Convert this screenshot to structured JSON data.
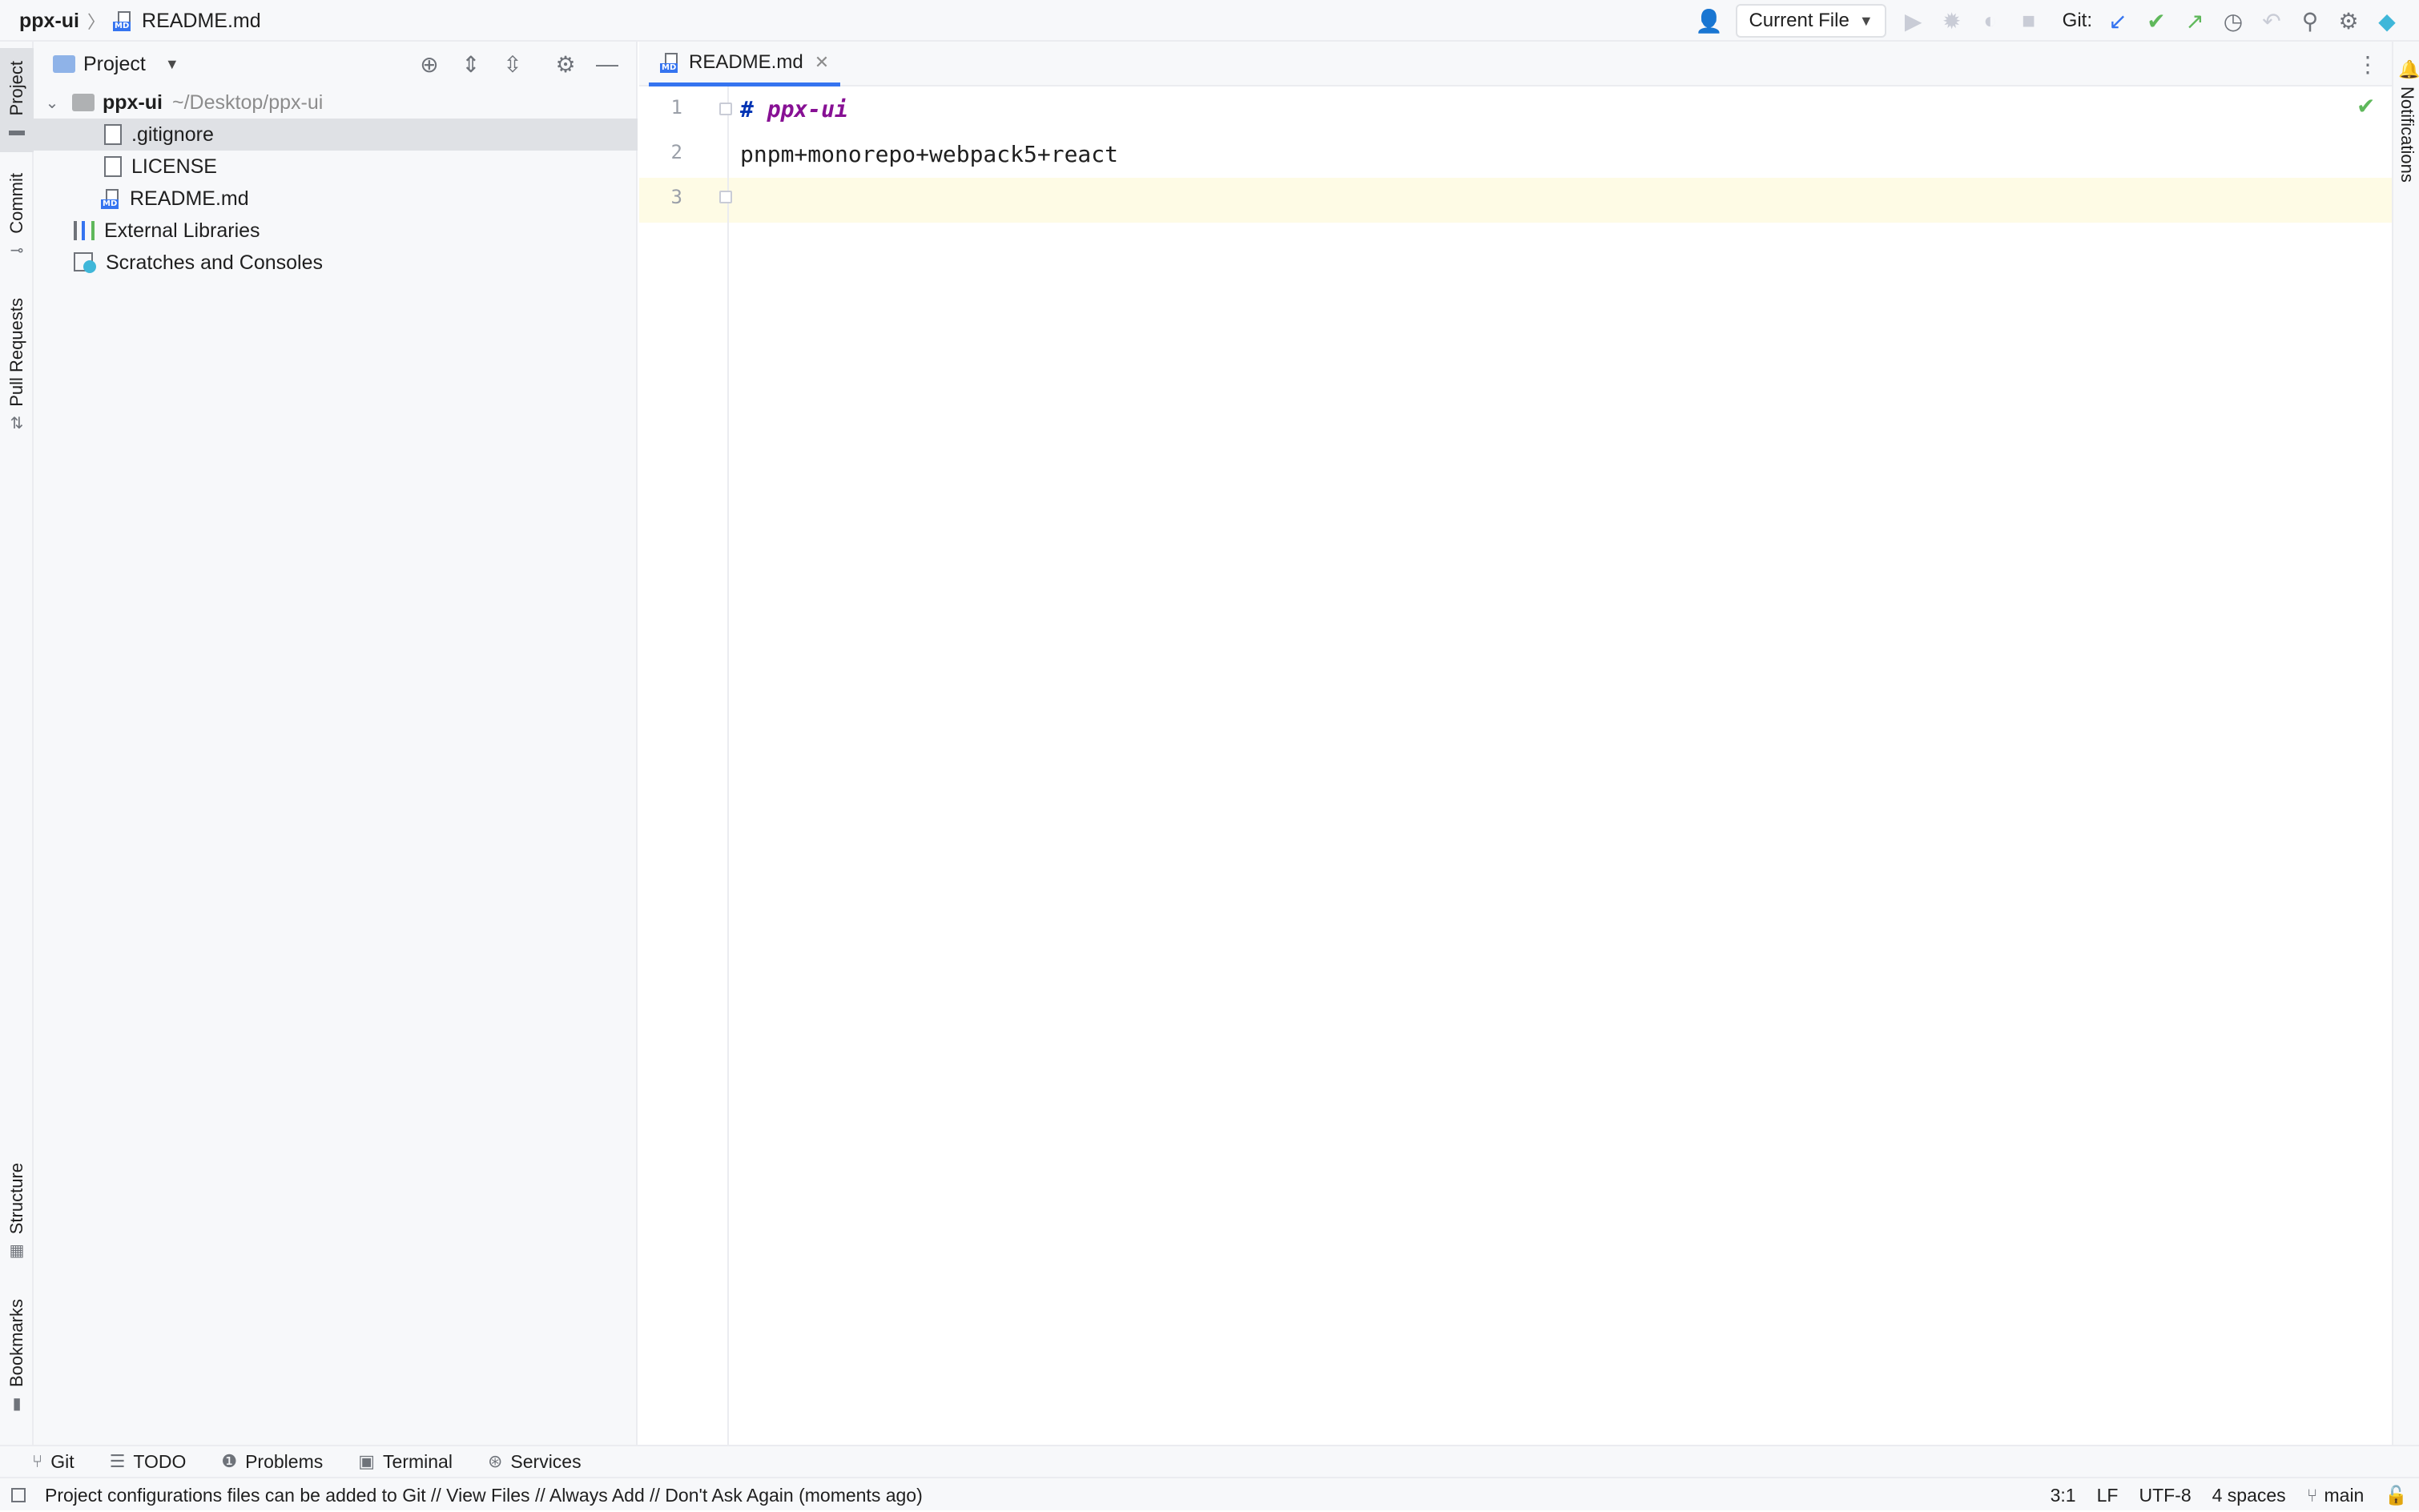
{
  "breadcrumb": {
    "project": "ppx-ui",
    "file": "README.md",
    "file_icon_tag": "MD"
  },
  "toolbar": {
    "run_config": "Current File",
    "git_label": "Git:"
  },
  "left_strip": {
    "project": "Project",
    "commit": "Commit",
    "pull_requests": "Pull Requests",
    "structure": "Structure",
    "bookmarks": "Bookmarks"
  },
  "right_strip": {
    "notifications": "Notifications"
  },
  "project_panel": {
    "title": "Project",
    "tree": [
      {
        "name": "ppx-ui",
        "hint": "~/Desktop/ppx-ui"
      },
      {
        "name": ".gitignore"
      },
      {
        "name": "LICENSE"
      },
      {
        "name": "README.md"
      },
      {
        "name": "External Libraries"
      },
      {
        "name": "Scratches and Consoles"
      }
    ]
  },
  "editor": {
    "tab": "README.md",
    "line_numbers": [
      "1",
      "2",
      "3"
    ],
    "lines": {
      "l1_hash": "#",
      "l1_heading": "ppx-ui",
      "l2": "pnpm+monorepo+webpack5+react",
      "l3": ""
    }
  },
  "bottom_tools": [
    {
      "label": "Git"
    },
    {
      "label": "TODO"
    },
    {
      "label": "Problems"
    },
    {
      "label": "Terminal"
    },
    {
      "label": "Services"
    }
  ],
  "statusbar": {
    "message": "Project configurations files can be added to Git // View Files // Always Add // Don't Ask Again (moments ago)",
    "caret_pos": "3:1",
    "line_sep": "LF",
    "encoding": "UTF-8",
    "indent": "4 spaces",
    "branch": "main"
  },
  "colors": {
    "accent": "#3574f0",
    "heading": "#871094",
    "ok": "#5fb85b",
    "caret_line": "#fefbe5"
  }
}
